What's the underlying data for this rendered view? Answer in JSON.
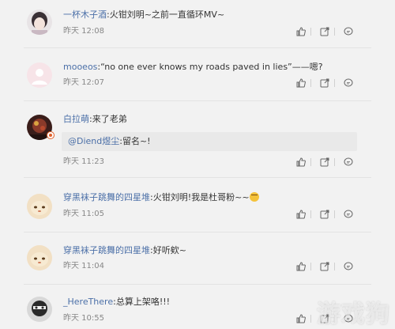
{
  "comments": [
    {
      "username": "一杯木子酒",
      "separator": ":",
      "text": "火钳刘明~之前一直循环MV~",
      "time": "昨天 12:08"
    },
    {
      "username": "mooeos",
      "separator": ":",
      "text": "“no one ever knows my roads paved in lies”——嗯?",
      "time": "昨天 12:07"
    },
    {
      "username": "白拉萌",
      "separator": ":",
      "text": "来了老弟",
      "quote": {
        "mention": "@Diend煜尘",
        "separator": ":",
        "text": "留名~!"
      },
      "time": "昨天 11:23"
    },
    {
      "username": "穿黑袜子跳舞的四星堆",
      "separator": ":",
      "text": "火钳刘明!我是杜哥粉~~",
      "time": "昨天 11:05"
    },
    {
      "username": "穿黑袜子跳舞的四星堆",
      "separator": ":",
      "text": "好听欸~",
      "time": "昨天 11:04"
    },
    {
      "username": "_HereThere",
      "separator": ":",
      "text": "总算上架咯!!!",
      "time": "昨天 10:55"
    }
  ],
  "icons": {
    "like": "thumbs-up-icon",
    "share": "share-icon",
    "reply": "comment-icon"
  },
  "watermark": {
    "text": "游戏狗"
  },
  "colors": {
    "username": "#4c70a8",
    "background": "#f2f2f2",
    "quote_background": "#e9e9e9"
  }
}
